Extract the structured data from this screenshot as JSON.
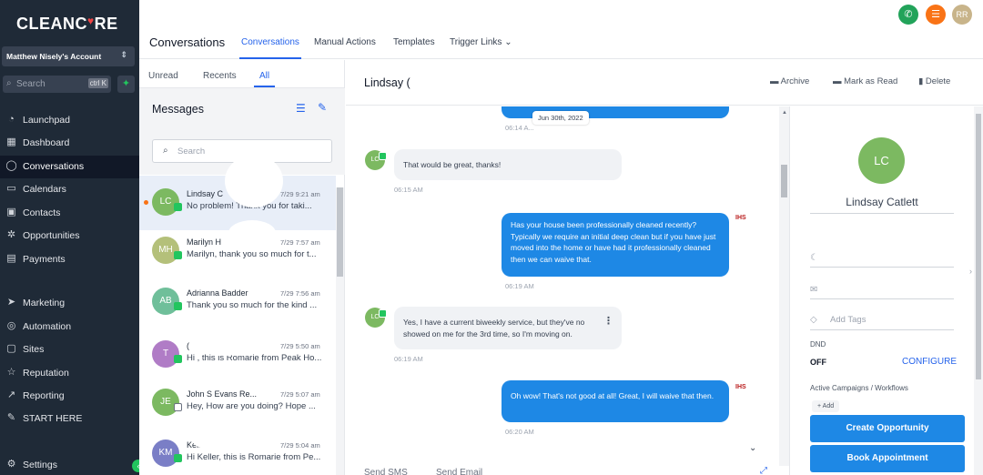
{
  "sidebar": {
    "logo_left": "CLEANC",
    "logo_heart": "♥",
    "logo_right": "RE",
    "account": "Matthew Nisely's Account",
    "search_placeholder": "Search",
    "search_shortcut": "ctrl K",
    "items": [
      {
        "label": "Launchpad",
        "icon": "rocket-icon"
      },
      {
        "label": "Dashboard",
        "icon": "grid-icon"
      },
      {
        "label": "Conversations",
        "icon": "chat-icon"
      },
      {
        "label": "Calendars",
        "icon": "calendar-icon"
      },
      {
        "label": "Contacts",
        "icon": "contacts-icon"
      },
      {
        "label": "Opportunities",
        "icon": "opportunities-icon"
      },
      {
        "label": "Payments",
        "icon": "receipt-icon"
      },
      {
        "label": "Marketing",
        "icon": "send-icon"
      },
      {
        "label": "Automation",
        "icon": "automation-icon"
      },
      {
        "label": "Sites",
        "icon": "sites-icon"
      },
      {
        "label": "Reputation",
        "icon": "star-icon"
      },
      {
        "label": "Reporting",
        "icon": "trend-icon"
      },
      {
        "label": "START HERE",
        "icon": "wrench-icon"
      },
      {
        "label": "Settings",
        "icon": "gear-icon"
      }
    ]
  },
  "topbar": {
    "title": "Conversations",
    "tabs": [
      "Conversations",
      "Manual Actions",
      "Templates",
      "Trigger Links"
    ],
    "user_initials": "RR"
  },
  "list": {
    "tabs": [
      "Unread",
      "Recents",
      "All"
    ],
    "heading": "Messages",
    "search_placeholder": "Search",
    "conversations": [
      {
        "initials": "LC",
        "name": "Lindsay C",
        "time": "7/29 9:21 am",
        "snippet": "No problem! Thank you for taki...",
        "color": "#7cb961",
        "channel": "sms"
      },
      {
        "initials": "MH",
        "name": "Marilyn H",
        "time": "7/29 7:57 am",
        "snippet": "Marilyn, thank you so much for t...",
        "color": "#b4c07a",
        "channel": "sms"
      },
      {
        "initials": "AB",
        "name": "Adrianna Badder",
        "time": "7/29 7:56 am",
        "snippet": "Thank you so much for the kind ...",
        "color": "#6fbf9a",
        "channel": "sms"
      },
      {
        "initials": "T",
        "name": "(",
        "time": "7/29 5:50 am",
        "snippet": "Hi , this is Romarie from Peak Ho...",
        "color": "#b07cc6",
        "channel": "sms"
      },
      {
        "initials": "JE",
        "name": "John S Evans Re...",
        "time": "7/29 5:07 am",
        "snippet": "Hey, How are you doing? Hope ...",
        "color": "#7cb961",
        "channel": "mail"
      },
      {
        "initials": "KM",
        "name": "Keller",
        "time": "7/29 5:04 am",
        "snippet": "Hi Keller, this is Romarie from Pe...",
        "color": "#7a7ec6",
        "channel": "sms"
      }
    ]
  },
  "chat": {
    "contact_name": "Lindsay (",
    "actions": [
      "Archive",
      "Mark as Read",
      "Delete"
    ],
    "date_chip": "Jun 30th, 2022",
    "messages": [
      {
        "dir": "in",
        "avatar": "LC",
        "text": "That would be great, thanks!",
        "time": "06:15 AM"
      },
      {
        "dir": "out",
        "text": "Has your house been professionally cleaned recently? Typically we require an initial deep clean but if you have just moved into the home or have had it professionally cleaned then we can waive that.",
        "time": "06:19 AM",
        "badge": "IHS"
      },
      {
        "dir": "in",
        "avatar": "LC",
        "text": "Yes, I have a current biweekly service, but they've no showed on me for the 3rd time, so I'm moving on.",
        "time": "06:19 AM"
      },
      {
        "dir": "out",
        "text": "Oh wow! That's not good at all! Great, I will waive that then.",
        "time": "06:20 AM",
        "badge": "IHS"
      }
    ],
    "first_time": "06:14 A...",
    "compose_tabs": [
      "Send SMS",
      "Send Email"
    ]
  },
  "contact": {
    "initials": "LC",
    "name": "Lindsay Catlett",
    "tags_placeholder": "Add Tags",
    "dnd_label": "DND",
    "dnd_value": "OFF",
    "configure": "CONFIGURE",
    "campaigns_label": "Active Campaigns / Workflows",
    "add_label": "+ Add",
    "create_button": "Create Opportunity",
    "book_button": "Book Appointment"
  }
}
